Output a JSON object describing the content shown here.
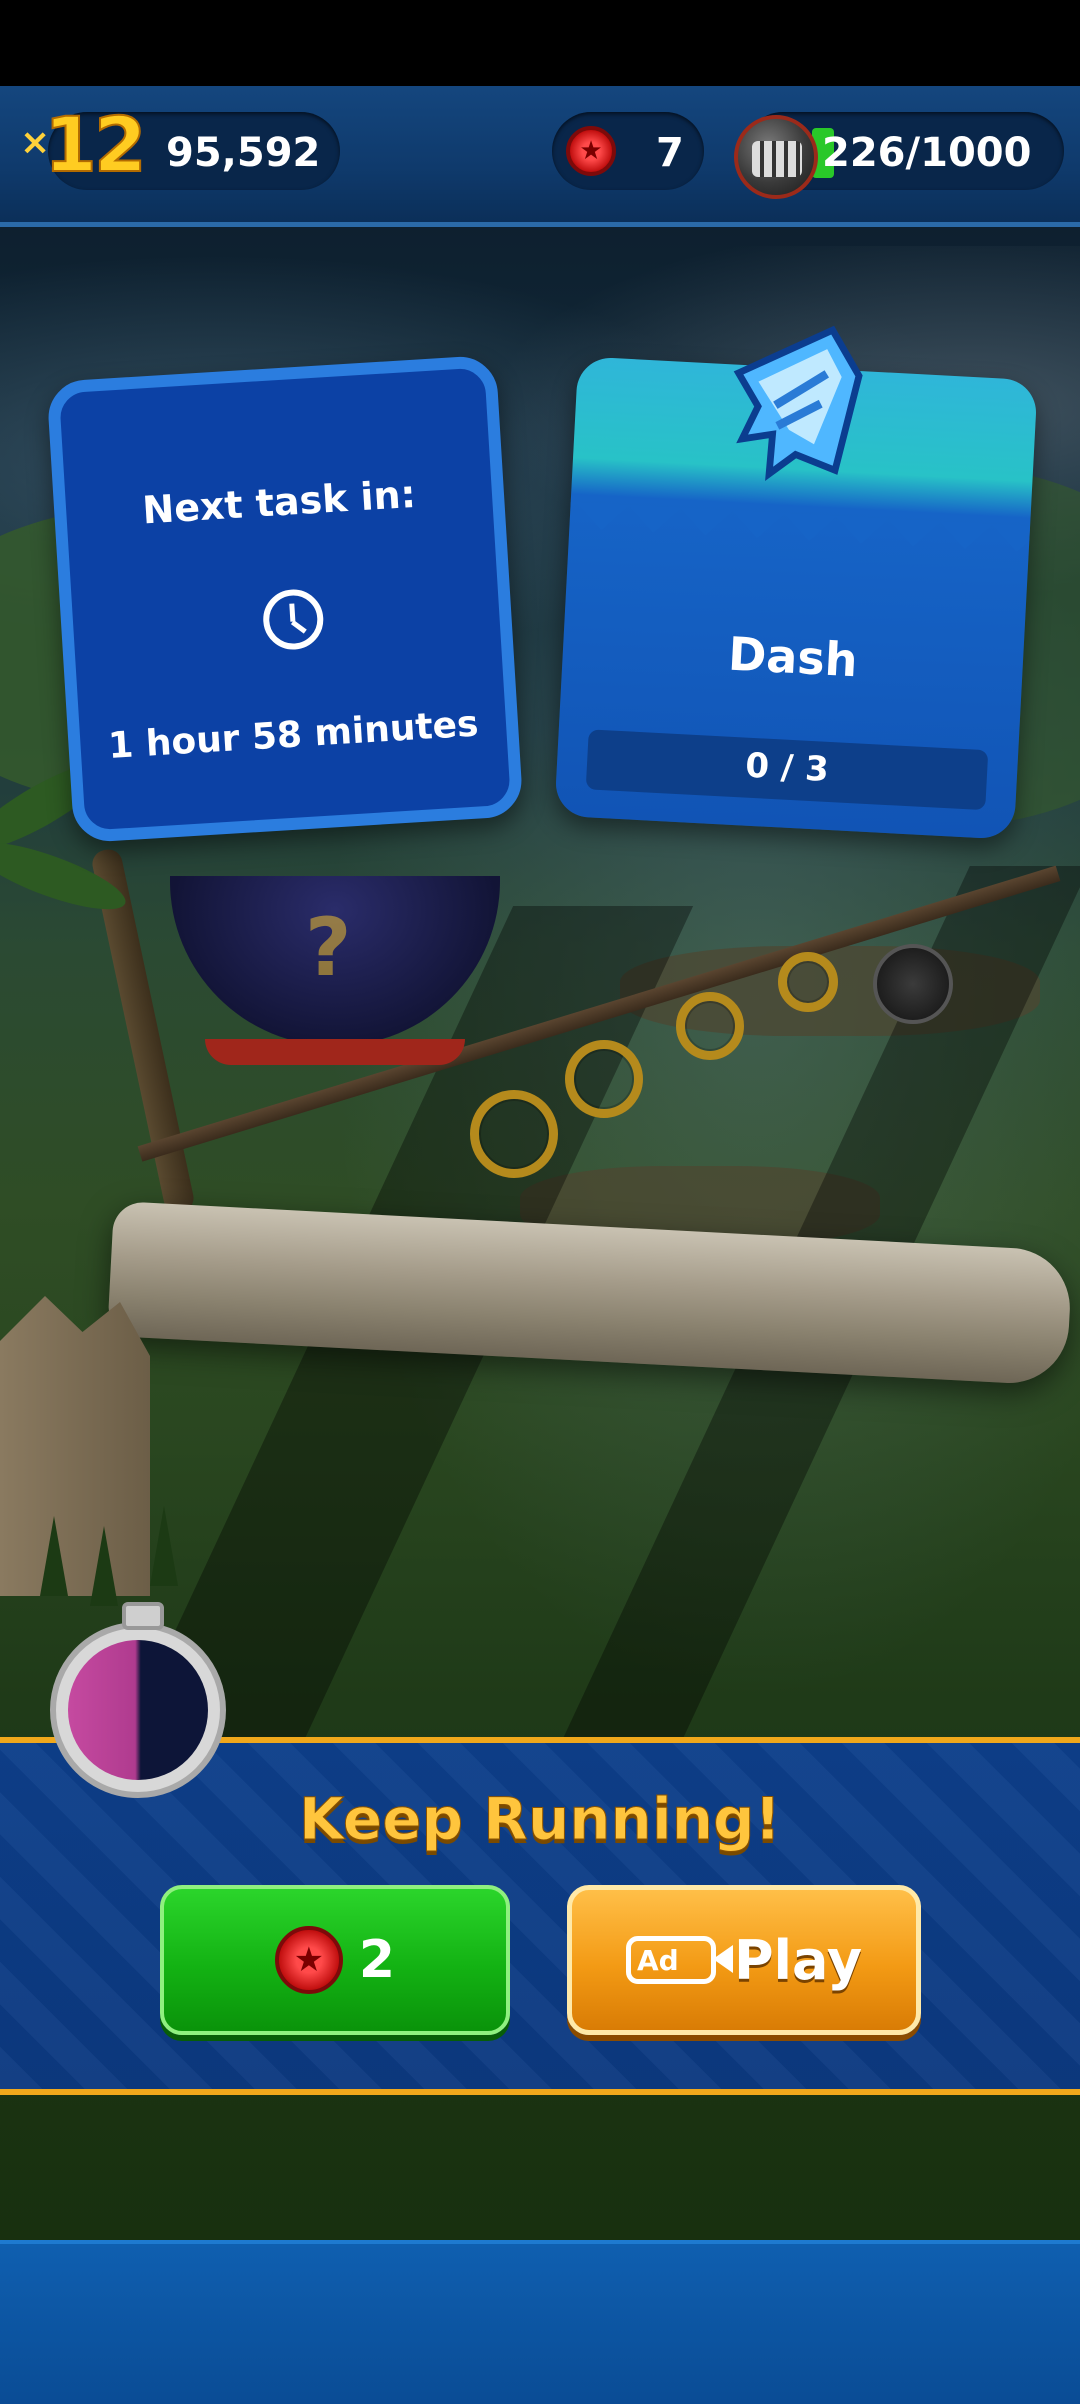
{
  "hud": {
    "multiplier_prefix": "×",
    "multiplier": "12",
    "score": "95,592",
    "red_star_rings": "7",
    "event_tokens": "226/1000"
  },
  "task_card": {
    "title": "Next task in:",
    "time_remaining": "1 hour 58 minutes"
  },
  "mission_card": {
    "title": "Dash",
    "progress": "0 / 3",
    "progress_value": 0,
    "progress_max": 3
  },
  "continue_panel": {
    "title": "Keep Running!",
    "red_star_cost": "2",
    "ad_label": "Ad",
    "play_label": "Play"
  },
  "colors": {
    "accent_gold": "#ffc53d",
    "hud_blue": "#14467e",
    "button_green": "#13b213",
    "button_orange": "#f39a14",
    "panel_border": "#f0a81c"
  },
  "icons": [
    "clock-icon",
    "red-star-ring-icon",
    "eggman-token-icon",
    "dash-crystal-icon",
    "stopwatch-icon",
    "video-ad-icon"
  ]
}
